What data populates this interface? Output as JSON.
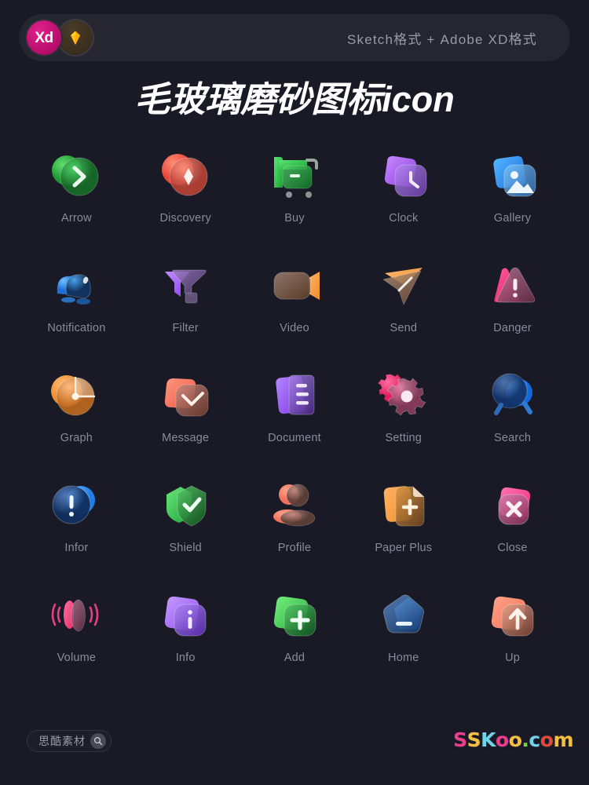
{
  "header": {
    "format_note": "Sketch格式 + Adobe XD格式",
    "badges": [
      {
        "name": "adobe-xd",
        "label": "Xd",
        "color": "#e0218a"
      },
      {
        "name": "sketch",
        "label": "",
        "color": "#fdb300"
      }
    ]
  },
  "title": "毛玻璃磨砂图标icon",
  "grid": {
    "columns": 5,
    "rows": 5,
    "items": [
      {
        "icon": "arrow-icon",
        "label": "Arrow",
        "color": "#3fbf52"
      },
      {
        "icon": "discovery-icon",
        "label": "Discovery",
        "color": "#f4604f"
      },
      {
        "icon": "buy-icon",
        "label": "Buy",
        "color": "#35c759"
      },
      {
        "icon": "clock-icon",
        "label": "Clock",
        "color": "#a86cf0"
      },
      {
        "icon": "gallery-icon",
        "label": "Gallery",
        "color": "#2f8df5"
      },
      {
        "icon": "notification-icon",
        "label": "Notification",
        "color": "#2f7de0"
      },
      {
        "icon": "filter-icon",
        "label": "Filter",
        "color": "#a25cf5"
      },
      {
        "icon": "video-icon",
        "label": "Video",
        "color": "#f79b3c"
      },
      {
        "icon": "send-icon",
        "label": "Send",
        "color": "#f79b3c"
      },
      {
        "icon": "danger-icon",
        "label": "Danger",
        "color": "#ec3f72"
      },
      {
        "icon": "graph-icon",
        "label": "Graph",
        "color": "#f79b3c"
      },
      {
        "icon": "message-icon",
        "label": "Message",
        "color": "#f4604f"
      },
      {
        "icon": "document-icon",
        "label": "Document",
        "color": "#8e5cf0"
      },
      {
        "icon": "setting-icon",
        "label": "Setting",
        "color": "#ec3f72"
      },
      {
        "icon": "search-icon",
        "label": "Search",
        "color": "#1f6fd0"
      },
      {
        "icon": "infor-icon",
        "label": "Infor",
        "color": "#2f8df5"
      },
      {
        "icon": "shield-icon",
        "label": "Shield",
        "color": "#3fbf52"
      },
      {
        "icon": "profile-icon",
        "label": "Profile",
        "color": "#f4836f"
      },
      {
        "icon": "paper-plus-icon",
        "label": "Paper Plus",
        "color": "#f79b3c"
      },
      {
        "icon": "close-icon",
        "label": "Close",
        "color": "#ec3f85"
      },
      {
        "icon": "volume-icon",
        "label": "Volume",
        "color": "#ec3f72"
      },
      {
        "icon": "info-icon",
        "label": "Info",
        "color": "#9a5cf5"
      },
      {
        "icon": "add-icon",
        "label": "Add",
        "color": "#3fbf52"
      },
      {
        "icon": "home-icon",
        "label": "Home",
        "color": "#2f8df5"
      },
      {
        "icon": "up-icon",
        "label": "Up",
        "color": "#f4836f"
      }
    ]
  },
  "footer": {
    "watermark_text": "思酷素材",
    "watermark_icon": "search-icon",
    "brand": {
      "letters": [
        {
          "ch": "S",
          "color": "#e83f8e"
        },
        {
          "ch": "S",
          "color": "#f0c040"
        },
        {
          "ch": "K",
          "color": "#6fd4e8"
        },
        {
          "ch": "o",
          "color": "#e83f8e"
        },
        {
          "ch": "o",
          "color": "#f0c040"
        },
        {
          "ch": ".",
          "color": "#7ad44a"
        },
        {
          "ch": "c",
          "color": "#6fd4e8"
        },
        {
          "ch": "o",
          "color": "#e04a3a"
        },
        {
          "ch": "m",
          "color": "#f0c040"
        }
      ]
    }
  },
  "theme": {
    "background": "#1a1a26",
    "header_bar": "#262631",
    "label_color": "#8a8a99"
  }
}
